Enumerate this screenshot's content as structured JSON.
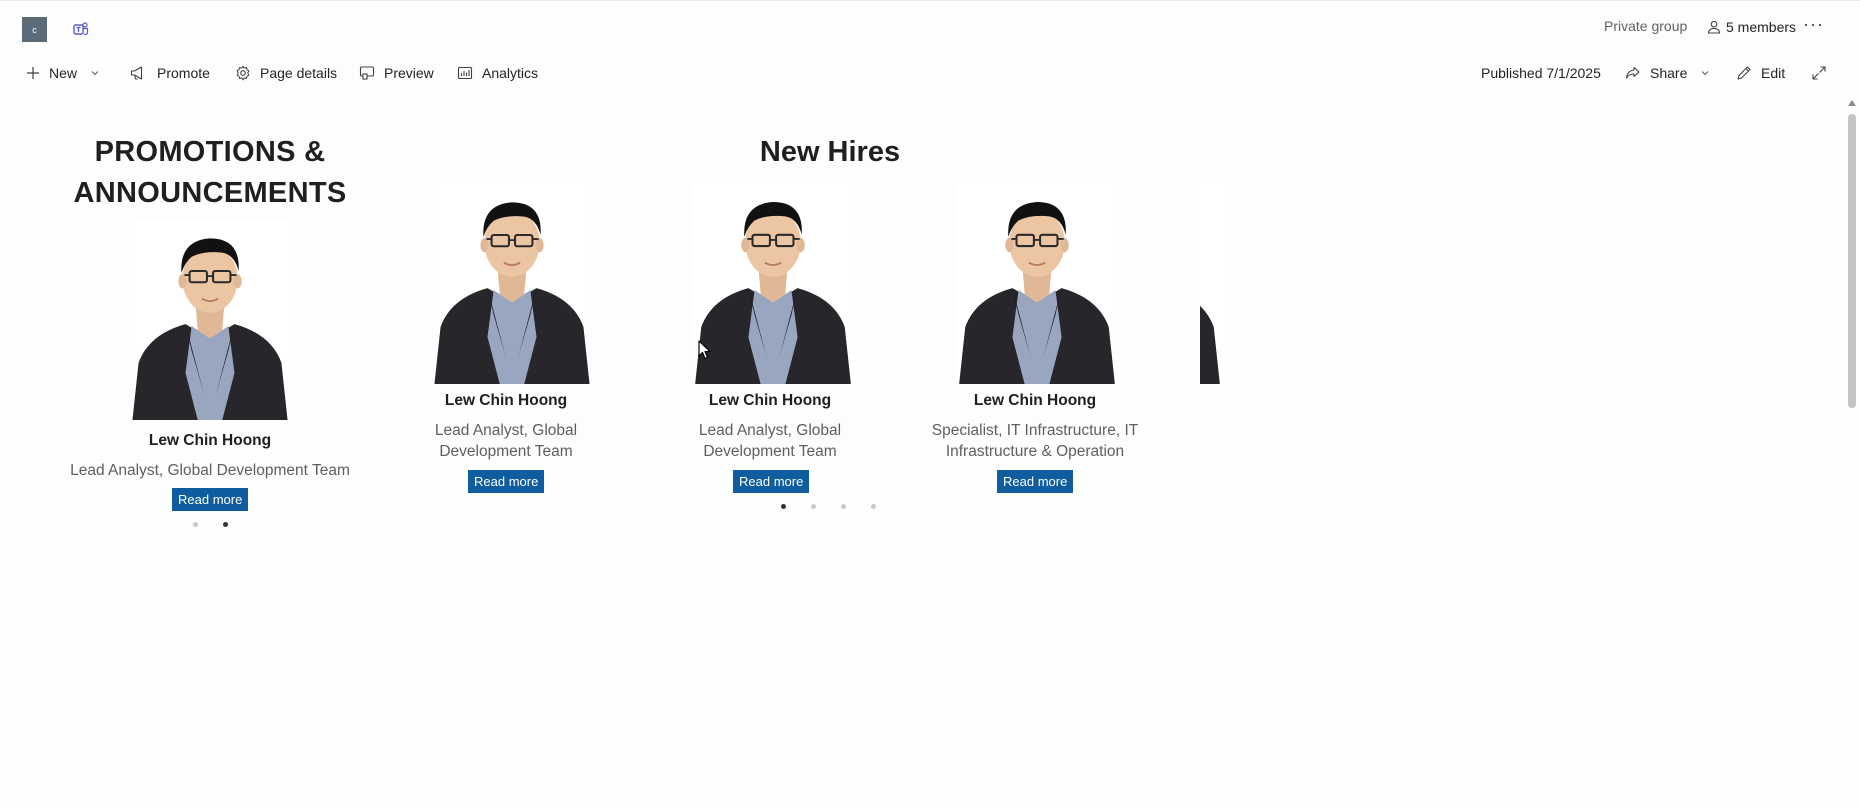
{
  "header": {
    "logo_letter": "c",
    "private_group": "Private group",
    "members": "5 members",
    "more": "···"
  },
  "commandbar": {
    "new": "New",
    "promote": "Promote",
    "page_details": "Page details",
    "preview": "Preview",
    "analytics": "Analytics",
    "published": "Published 7/1/2025",
    "share": "Share",
    "edit": "Edit"
  },
  "promotions": {
    "title_line1": "PROMOTIONS &",
    "title_line2": "ANNOUNCEMENTS",
    "card": {
      "name": "Lew Chin Hoong",
      "role": "Lead Analyst, Global Development Team",
      "read_more": "Read more"
    },
    "dots": 2,
    "active_dot": 2
  },
  "new_hires": {
    "title": "New Hires",
    "cards": [
      {
        "name": "Lew Chin Hoong",
        "role_line1": "Lead Analyst, Global",
        "role_line2": "Development Team",
        "read_more": "Read more"
      },
      {
        "name": "Lew Chin Hoong",
        "role_line1": "Lead Analyst, Global",
        "role_line2": "Development Team",
        "read_more": "Read more"
      },
      {
        "name": "Lew Chin Hoong",
        "role_line1": "Specialist, IT Infrastructure, IT",
        "role_line2": "Infrastructure & Operation",
        "read_more": "Read more"
      }
    ],
    "dots": 4,
    "active_dot": 1
  },
  "colors": {
    "read_more_bg": "#0f5d9e",
    "logo_bg": "#5b6b78"
  }
}
